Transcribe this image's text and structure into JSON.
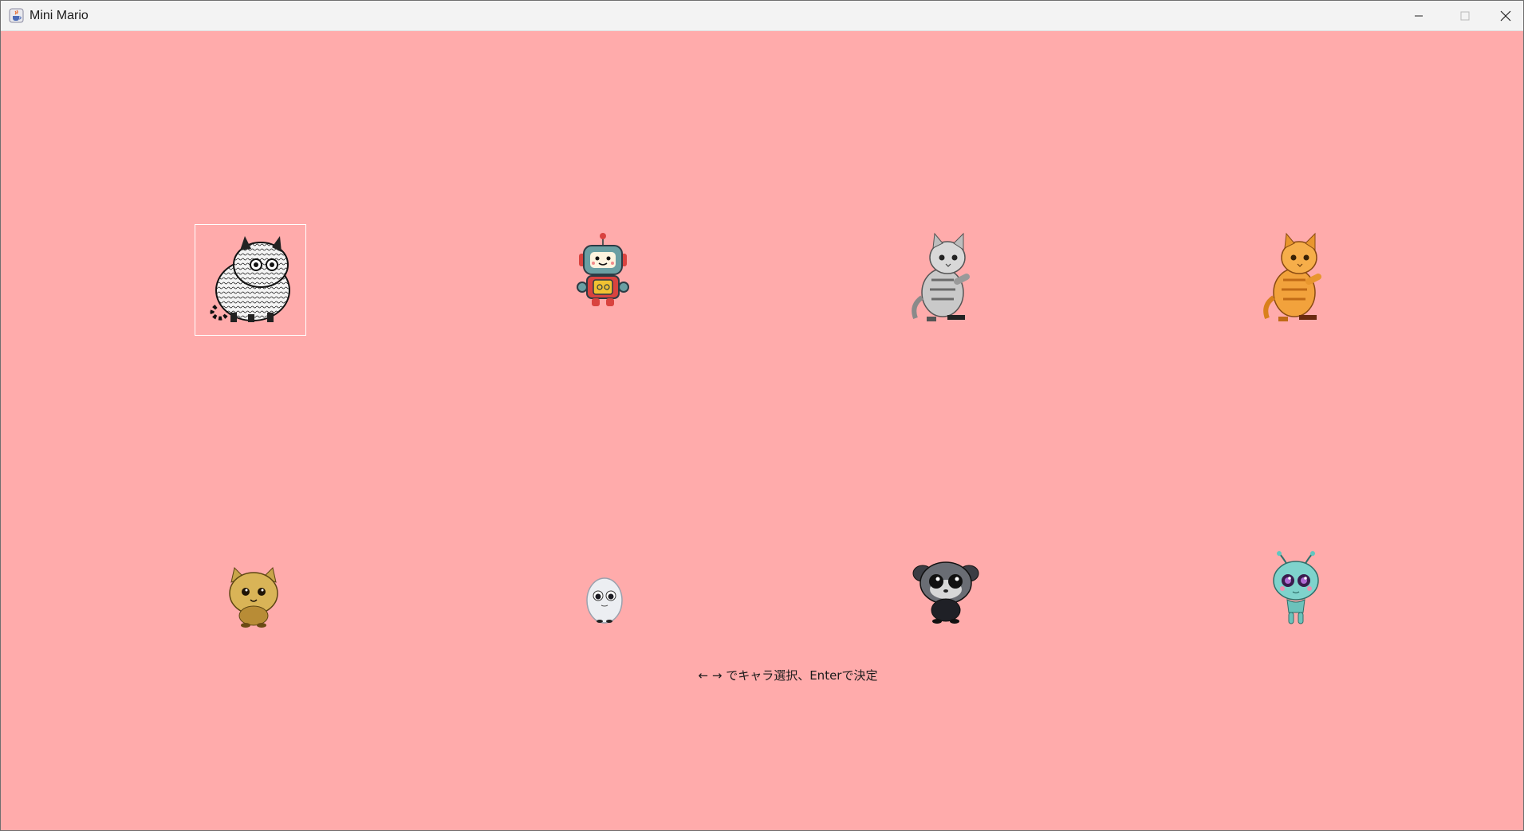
{
  "window": {
    "title": "Mini Mario",
    "icon": "java-cup-icon",
    "controls": [
      "minimize-icon",
      "maximize-icon",
      "close-icon"
    ]
  },
  "stage": {
    "background": "#ffabab",
    "selected_index": 0,
    "characters": [
      {
        "id": "striped-fluffy-cat",
        "icon": "sketch-cat-icon"
      },
      {
        "id": "robot",
        "icon": "robot-icon"
      },
      {
        "id": "grey-tabby-kitten",
        "icon": "grey-kitten-icon"
      },
      {
        "id": "orange-tabby-kitten",
        "icon": "orange-kitten-icon"
      },
      {
        "id": "yellow-fluffy-creature",
        "icon": "yellow-creature-icon"
      },
      {
        "id": "white-egg-creature",
        "icon": "egg-creature-icon"
      },
      {
        "id": "dark-fluffy-creature",
        "icon": "dark-creature-icon"
      },
      {
        "id": "teal-alien",
        "icon": "alien-icon"
      }
    ]
  },
  "hint_text": "← → でキャラ選択、Enterで決定"
}
